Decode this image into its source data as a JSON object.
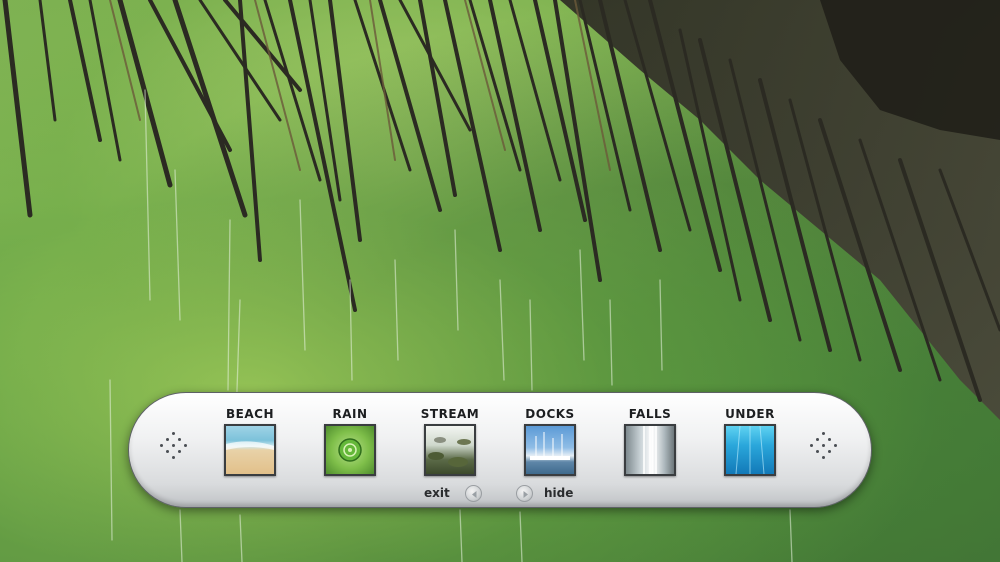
{
  "background": {
    "description_color_primary": "#7fb255",
    "description_color_dark": "#3b3a30"
  },
  "scene_bar": {
    "scenes": [
      {
        "label": "BEACH",
        "icon": "beach-thumbnail"
      },
      {
        "label": "RAIN",
        "icon": "rain-thumbnail"
      },
      {
        "label": "STREAM",
        "icon": "stream-thumbnail"
      },
      {
        "label": "DOCKS",
        "icon": "docks-thumbnail"
      },
      {
        "label": "FALLS",
        "icon": "falls-thumbnail"
      },
      {
        "label": "UNDER",
        "icon": "underwater-thumbnail"
      }
    ],
    "exit_label": "exit",
    "hide_label": "hide",
    "selected_scene": "RAIN",
    "accent_color": "#6dc13a"
  }
}
